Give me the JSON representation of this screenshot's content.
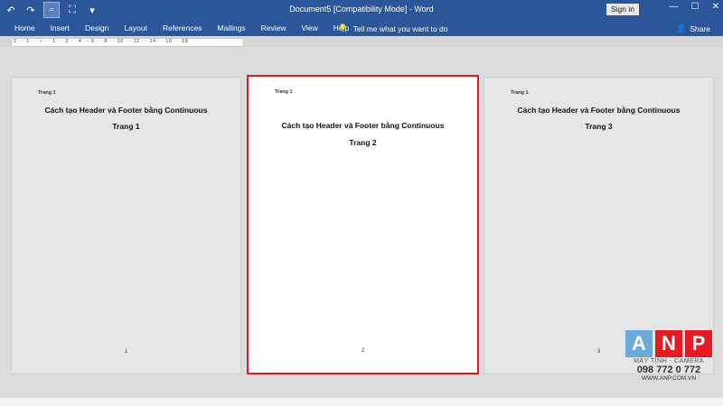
{
  "window": {
    "title": "Document5 [Compatibility Mode]  -  Word",
    "signin": "Sign in",
    "min": "—",
    "max": "☐",
    "close": "✕"
  },
  "qat": {
    "undo": "↶",
    "redo": "↷",
    "new": "▫",
    "focus": "⛶",
    "more": "▾"
  },
  "ribbon": {
    "tabs": [
      "Home",
      "Insert",
      "Design",
      "Layout",
      "References",
      "Mailings",
      "Review",
      "View",
      "Help"
    ],
    "tell_me": "Tell me what you want to do",
    "share": "Share"
  },
  "ruler": {
    "numbers": "2 · · 1 · · ⌂ · · 1 · · 2 · · 4 · · 6 · · 8 · · 10 · · 12 · · 14 · · 16 · · 18"
  },
  "pages": [
    {
      "header": "Trang 1",
      "title": "Cách tạo Header và Footer bằng Continuous",
      "label": "Trang 1",
      "number": "1"
    },
    {
      "header": "Trang 1",
      "title": "Cách tạo Header và Footer bằng Continuous",
      "label": "Trang 2",
      "number": "2"
    },
    {
      "header": "Trang 1",
      "title": "Cách tạo Header và Footer bằng Continuous",
      "label": "Trang 3",
      "number": "3"
    }
  ],
  "watermark": {
    "letters": [
      "A",
      "N",
      "P"
    ],
    "colors": [
      "#6aa9d8",
      "#e31b23",
      "#e31b23"
    ],
    "subtitle": "MÁY TÍNH - CAMERA",
    "phone": "098 772 0 772",
    "website": "WWW.ANP.COM.VN"
  }
}
